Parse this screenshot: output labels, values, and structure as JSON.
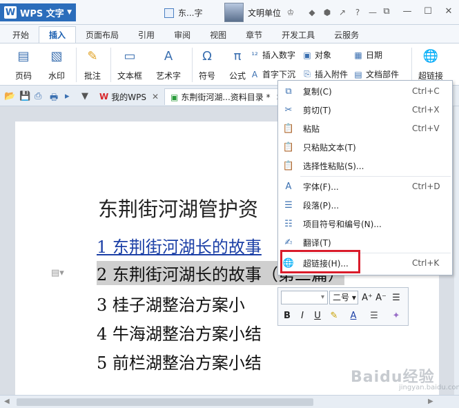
{
  "titlebar": {
    "app_name": "WPS 文字",
    "doc_short_title": "东...字",
    "user_name": "文明单位"
  },
  "ribbon_tabs": [
    "开始",
    "插入",
    "页面布局",
    "引用",
    "审阅",
    "视图",
    "章节",
    "开发工具",
    "云服务"
  ],
  "ribbon": {
    "page_number": "页码",
    "watermark": "水印",
    "comment": "批注",
    "textbox": "文本框",
    "wordart": "艺术字",
    "symbol": "符号",
    "formula": "公式",
    "insert_number": "插入数字",
    "drop_cap": "首字下沉",
    "object": "对象",
    "insert_attachment": "插入附件",
    "date": "日期",
    "doc_parts": "文档部件",
    "hyperlink": "超链接"
  },
  "doc_tabs": {
    "my_wps": "我的WPS",
    "active_doc": "东荆街河湖...资料目录 *"
  },
  "document": {
    "heading": "东荆街河湖管护资",
    "lines": [
      "1 东荆街河湖长的故事",
      "2 东荆街河湖长的故事（第二篇）",
      "3  桂子湖整治方案小",
      "4  牛海湖整治方案小结",
      "5  前栏湖整治方案小结"
    ]
  },
  "context_menu": {
    "items": [
      {
        "label": "复制(C)",
        "shortcut": "Ctrl+C",
        "icon": "copy-icon"
      },
      {
        "label": "剪切(T)",
        "shortcut": "Ctrl+X",
        "icon": "scissors-icon"
      },
      {
        "label": "粘贴",
        "shortcut": "Ctrl+V",
        "icon": "paste-icon"
      },
      {
        "label": "只粘贴文本(T)",
        "shortcut": "",
        "icon": "paste-text-icon"
      },
      {
        "label": "选择性粘贴(S)...",
        "shortcut": "",
        "icon": "paste-special-icon"
      },
      {
        "label": "字体(F)...",
        "shortcut": "Ctrl+D",
        "icon": "font-icon"
      },
      {
        "label": "段落(P)...",
        "shortcut": "",
        "icon": "paragraph-icon"
      },
      {
        "label": "项目符号和编号(N)...",
        "shortcut": "",
        "icon": "bullets-icon"
      },
      {
        "label": "翻译(T)",
        "shortcut": "",
        "icon": "translate-icon"
      },
      {
        "label": "超链接(H)...",
        "shortcut": "Ctrl+K",
        "icon": "hyperlink-icon"
      }
    ]
  },
  "mini_toolbar": {
    "font_size": "二号",
    "bold": "B",
    "italic": "I",
    "underline": "U"
  },
  "watermark": {
    "text": "Baidu经验",
    "sub": "jingyan.baidu.com"
  },
  "colors": {
    "accent": "#2b6dbb",
    "highlight": "#d91b2a",
    "link": "#1b3fa6"
  }
}
